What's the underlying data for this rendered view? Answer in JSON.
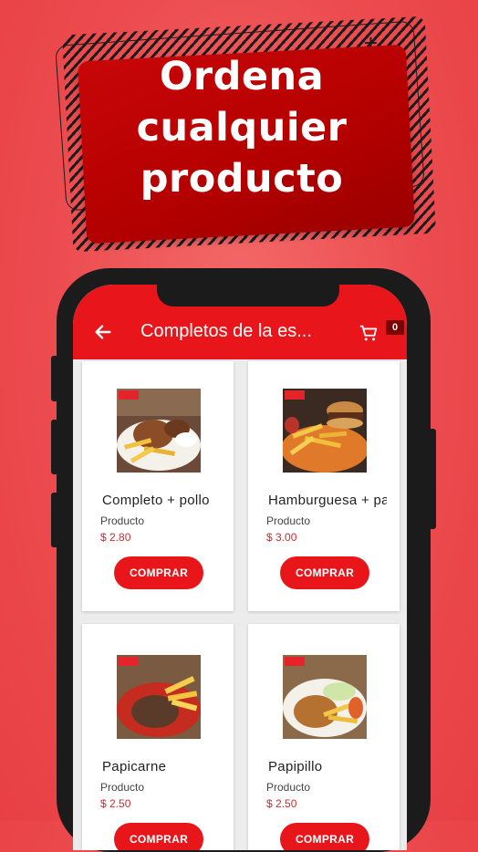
{
  "banner": {
    "line1": "Ordena",
    "line2": "cualquier",
    "line3": "producto"
  },
  "appbar": {
    "title": "Completos de la es...",
    "cart_count": "0"
  },
  "products": [
    {
      "name": "Completo + pollo",
      "category": "Producto",
      "price": "$ 2.80",
      "button": "COMPRAR"
    },
    {
      "name": "Hamburguesa + papas",
      "category": "Producto",
      "price": "$ 3.00",
      "button": "COMPRAR"
    },
    {
      "name": "Papicarne",
      "category": "Producto",
      "price": "$ 2.50",
      "button": "COMPRAR"
    },
    {
      "name": "Papipillo",
      "category": "Producto",
      "price": "$ 2.50",
      "button": "COMPRAR"
    }
  ],
  "colors": {
    "background": "#ec4c4f",
    "accent": "#e8151a",
    "banner": "#b30000",
    "price": "#d9242a"
  }
}
